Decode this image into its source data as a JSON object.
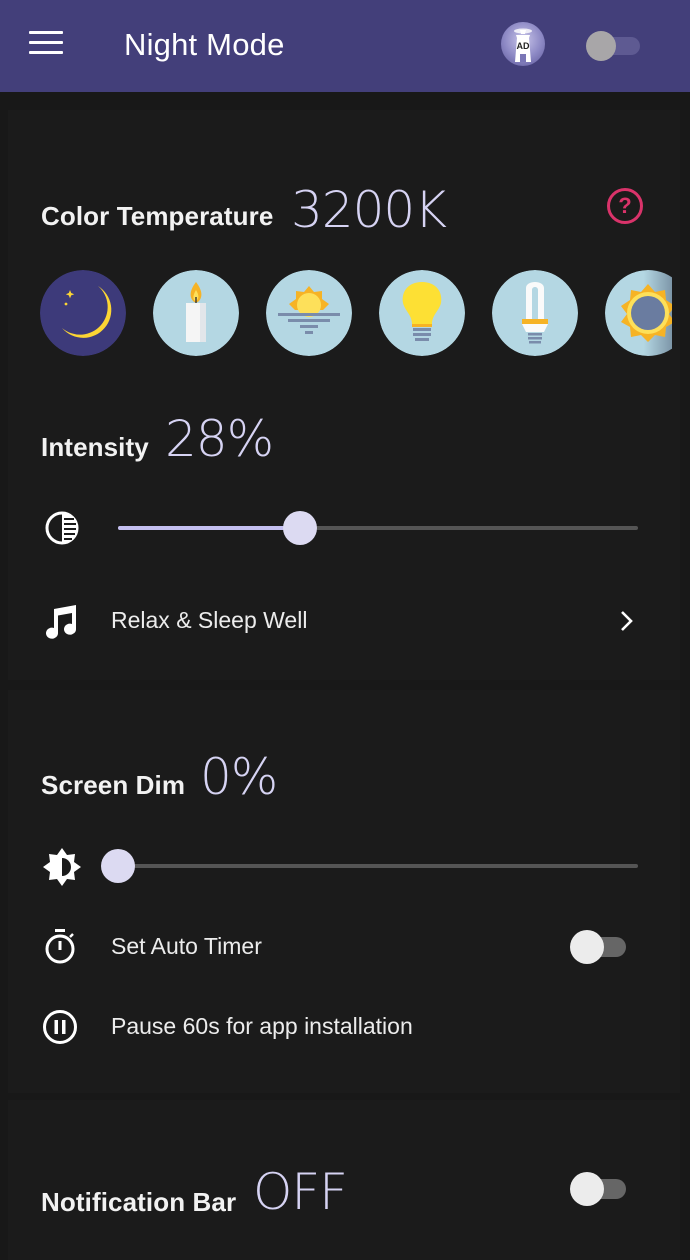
{
  "app_bar": {
    "title": "Night Mode",
    "menu_icon": "hamburger-menu-icon",
    "ad_icon": "lighthouse-ad-icon",
    "ad_label": "AD",
    "master_toggle": {
      "on": false
    },
    "color": "#433f7a"
  },
  "color_temperature": {
    "label": "Color Temperature",
    "value": "3200K",
    "help_icon": "help-circle-icon",
    "help_color": "#d9336a",
    "presets": [
      {
        "name": "moon",
        "icon": "moon-icon",
        "selected": true
      },
      {
        "name": "candle",
        "icon": "candle-icon",
        "selected": false
      },
      {
        "name": "sunrise",
        "icon": "sunrise-icon",
        "selected": false
      },
      {
        "name": "incandescent",
        "icon": "light-bulb-icon",
        "selected": false
      },
      {
        "name": "fluorescent",
        "icon": "cfl-bulb-icon",
        "selected": false
      },
      {
        "name": "sun",
        "icon": "sun-icon",
        "selected": false
      }
    ]
  },
  "intensity": {
    "label": "Intensity",
    "value": "28%",
    "slider_fraction": 0.35,
    "icon": "contrast-icon"
  },
  "relax": {
    "label": "Relax & Sleep Well",
    "icon": "music-note-icon",
    "chevron": "chevron-right-icon"
  },
  "screen_dim": {
    "label": "Screen Dim",
    "value": "0%",
    "slider_fraction": 0.0,
    "icon": "brightness-icon"
  },
  "auto_timer": {
    "label": "Set Auto Timer",
    "icon": "stopwatch-icon",
    "toggle": {
      "on": false
    }
  },
  "pause": {
    "label": "Pause 60s for app installation",
    "icon": "pause-circle-icon"
  },
  "notification_bar": {
    "label": "Notification Bar",
    "value": "OFF",
    "toggle": {
      "on": false
    }
  }
}
